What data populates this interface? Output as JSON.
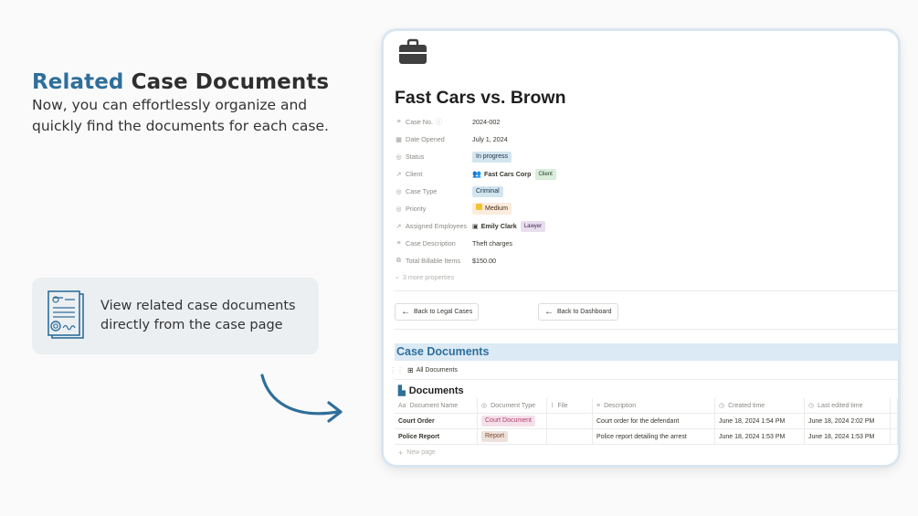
{
  "promo": {
    "headline_accent": "Related",
    "headline_rest": "Case Documents",
    "subtitle": "Now, you can effortlessly organize and quickly find the documents for each case.",
    "feature_text": "View related case documents directly from the case page"
  },
  "page": {
    "icon": "briefcase-icon",
    "title": "Fast Cars vs. Brown"
  },
  "properties": {
    "case_no": {
      "label": "Case No.",
      "value": "2024-002"
    },
    "date_opened": {
      "label": "Date Opened",
      "value": "July 1, 2024"
    },
    "status": {
      "label": "Status",
      "value": "In progress"
    },
    "client": {
      "label": "Client",
      "value": "Fast Cars Corp",
      "tag": "Client"
    },
    "case_type": {
      "label": "Case Type",
      "value": "Criminal"
    },
    "priority": {
      "label": "Priority",
      "value": "Medium"
    },
    "assigned": {
      "label": "Assigned Employees",
      "value": "Emily Clark",
      "tag": "Lawyer"
    },
    "description": {
      "label": "Case Description",
      "value": "Theft charges"
    },
    "billable": {
      "label": "Total Billable Items",
      "value": "$150.00"
    },
    "more": "3 more properties"
  },
  "buttons": {
    "back_legal": "Back to Legal Cases",
    "back_dashboard": "Back to Dashboard"
  },
  "section": {
    "title": "Case Documents",
    "view_tab": "All Documents",
    "db_title": "Documents"
  },
  "table": {
    "headers": [
      "Document Name",
      "Document Type",
      "File",
      "Description",
      "Created time",
      "Last edited time"
    ],
    "rows": [
      [
        "Court Order",
        "Court Document",
        "",
        "Court order for the defendant",
        "June 18, 2024 1:54 PM",
        "June 18, 2024 2:02 PM"
      ],
      [
        "Police Report",
        "Report",
        "",
        "Police report detailing the arrest",
        "June 18, 2024 1:53 PM",
        "June 18, 2024 1:53 PM"
      ]
    ],
    "new_page": "New page"
  },
  "colors": {
    "accent": "#2f6f9a",
    "section_bg": "#dbeaf4"
  }
}
